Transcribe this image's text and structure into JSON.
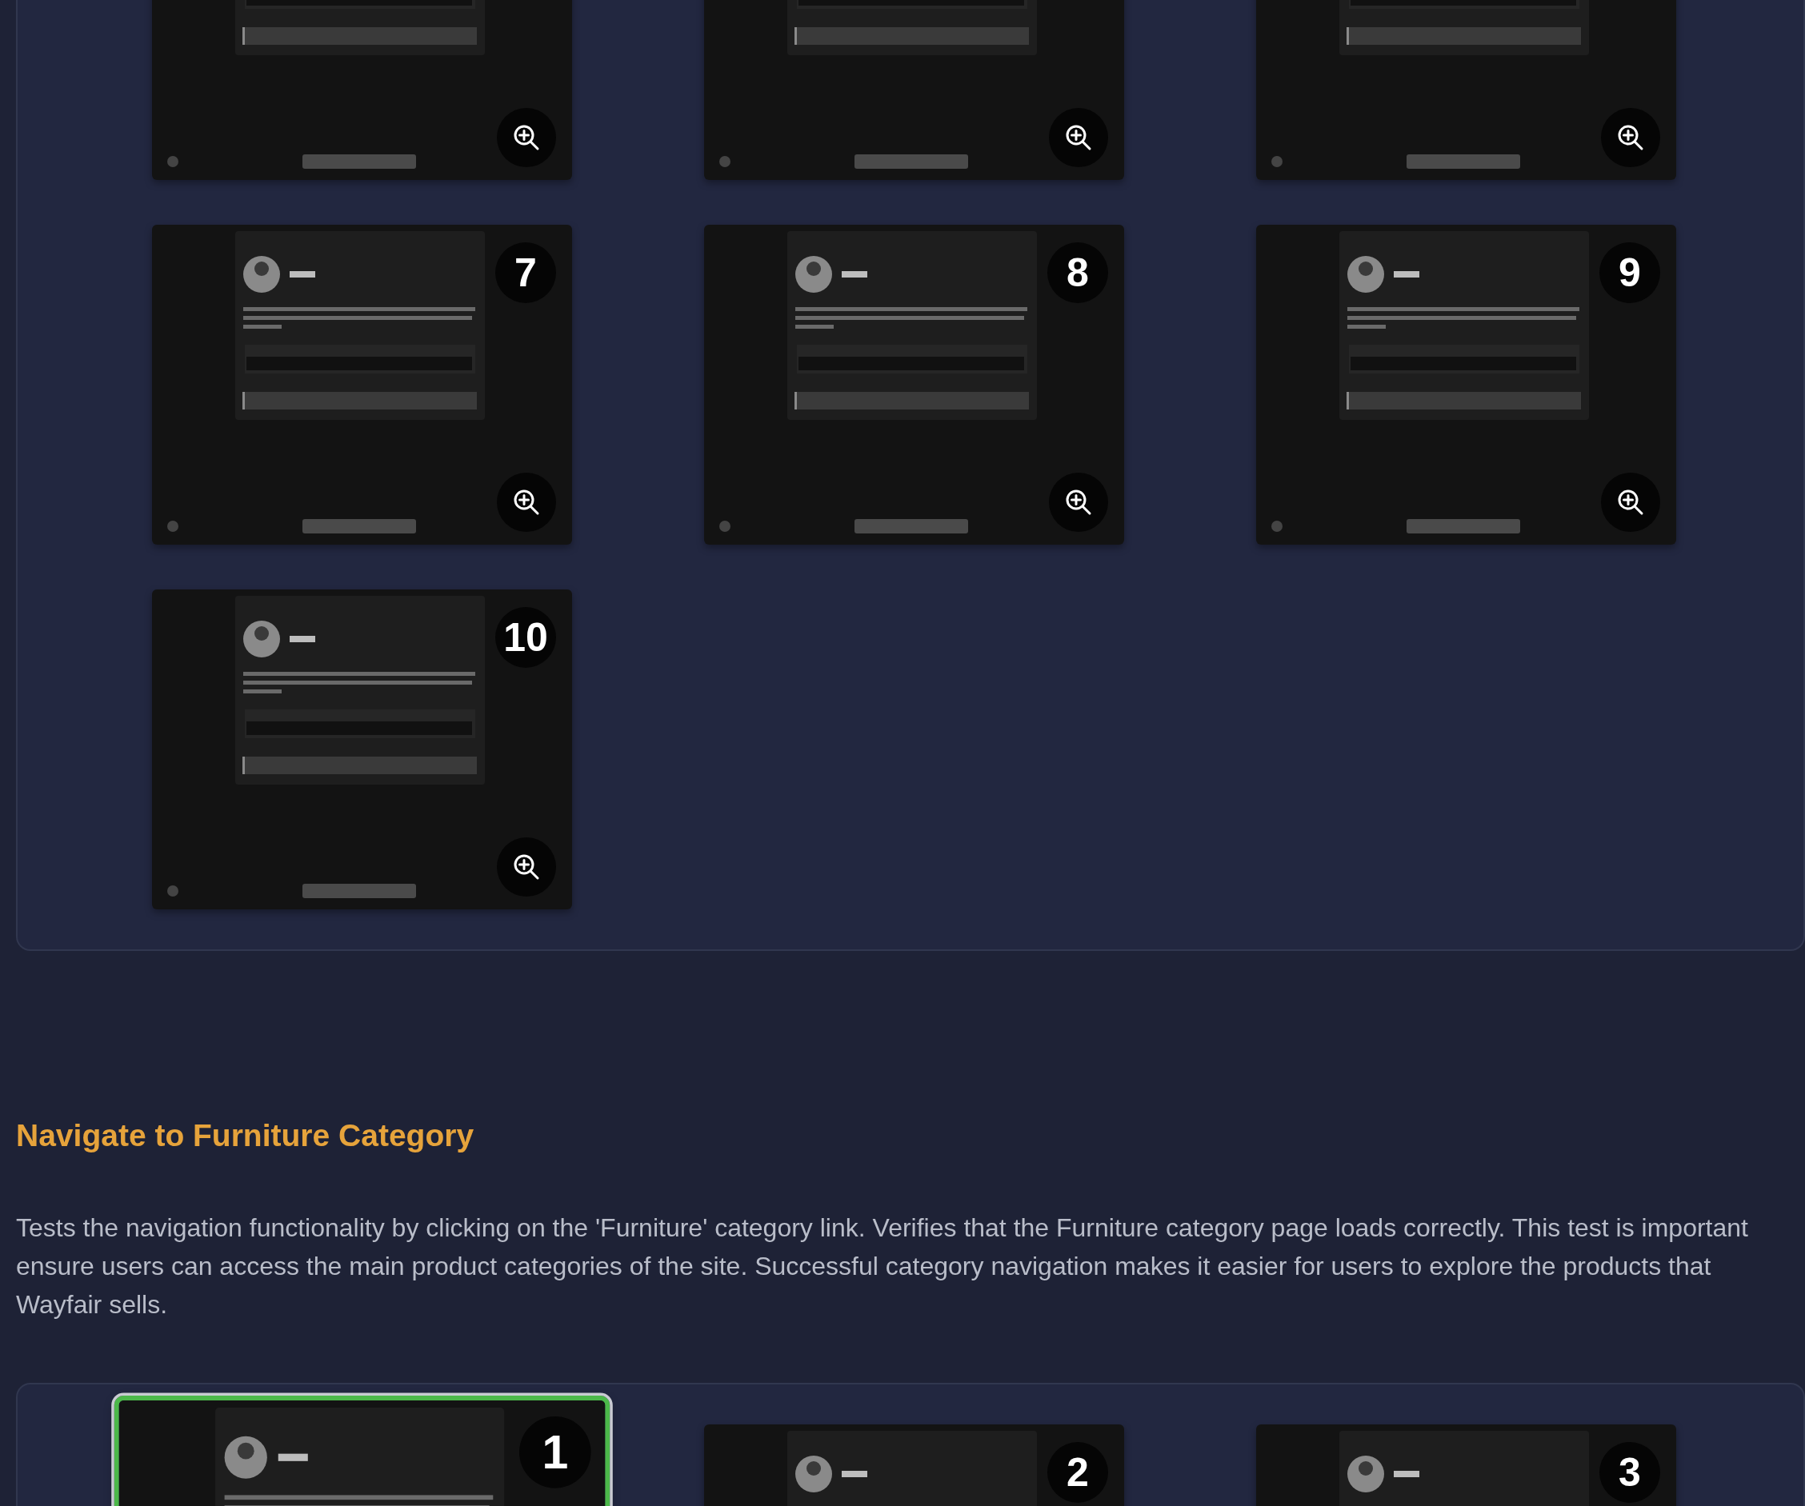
{
  "sections": [
    {
      "steps": [
        {
          "selected": false,
          "zoom_button": true
        },
        {
          "selected": false,
          "zoom_button": true
        },
        {
          "selected": false,
          "zoom_button": true
        },
        {
          "number": "7",
          "selected": false,
          "zoom_button": true
        },
        {
          "number": "8",
          "selected": false,
          "zoom_button": true
        },
        {
          "number": "9",
          "selected": false,
          "zoom_button": true
        },
        {
          "number": "10",
          "selected": false,
          "zoom_button": true
        }
      ]
    },
    {
      "title": "Navigate to Furniture Category",
      "description": [
        "Tests the navigation functionality by clicking on the 'Furniture' category link. Verifies that the Furniture category page loads correctly. This test is important",
        "ensure users can access the main product categories of the site. Successful category navigation makes it easier for users to explore the products that",
        "Wayfair sells."
      ],
      "steps": [
        {
          "number": "1",
          "selected": true
        },
        {
          "number": "2",
          "selected": false
        },
        {
          "number": "3",
          "selected": false
        }
      ]
    }
  ]
}
